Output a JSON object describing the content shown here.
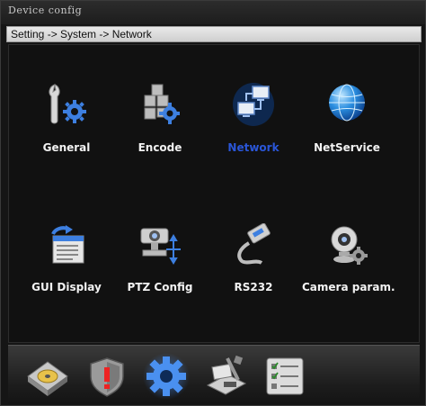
{
  "window": {
    "title": "Device config"
  },
  "breadcrumb": "Setting -> System -> Network",
  "tiles": [
    {
      "label": "General",
      "icon": "wrench-gear-icon"
    },
    {
      "label": "Encode",
      "icon": "encode-cubes-icon"
    },
    {
      "label": "Network",
      "icon": "network-monitors-icon",
      "selected": true
    },
    {
      "label": "NetService",
      "icon": "globe-icon"
    },
    {
      "label": "GUI Display",
      "icon": "gui-display-icon"
    },
    {
      "label": "PTZ Config",
      "icon": "ptz-camera-icon"
    },
    {
      "label": "RS232",
      "icon": "serial-cable-icon"
    },
    {
      "label": "Camera param.",
      "icon": "webcam-gear-icon"
    }
  ],
  "dock": [
    {
      "icon": "hdd-icon"
    },
    {
      "icon": "alarm-shield-icon"
    },
    {
      "icon": "system-gear-icon",
      "selected": true
    },
    {
      "icon": "tools-icon"
    },
    {
      "icon": "checklist-icon"
    }
  ],
  "colors": {
    "selected_label": "#2a56d8",
    "label": "#f2f2f2",
    "background": "#111111"
  }
}
